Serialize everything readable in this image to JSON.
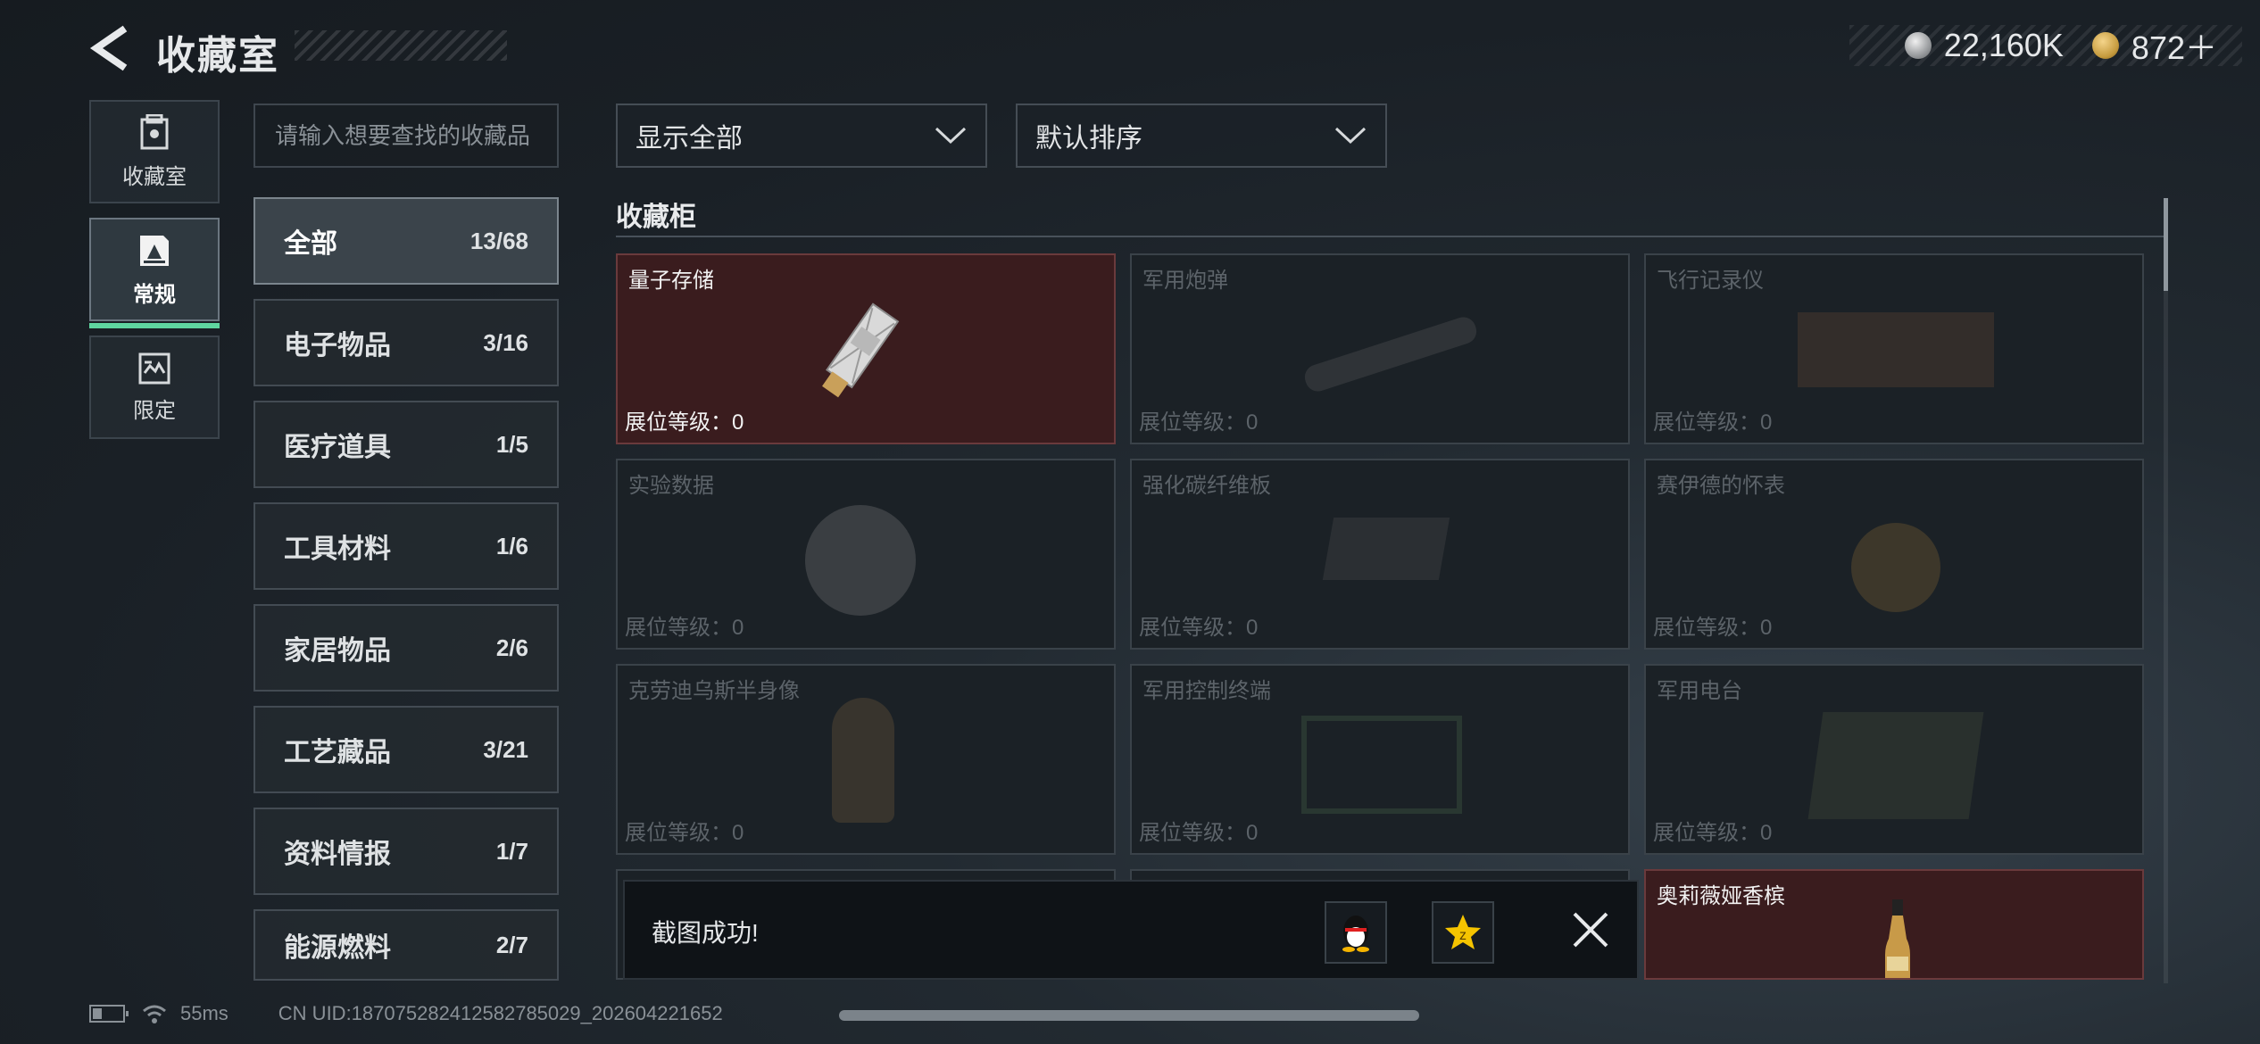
{
  "header": {
    "title": "收藏室"
  },
  "currency": [
    {
      "icon": "silver-coin-icon",
      "value": "22,160K"
    },
    {
      "icon": "gold-coin-icon",
      "value": "872＋"
    }
  ],
  "left_tabs": [
    {
      "label": "收藏室",
      "icon": "collection-room-icon",
      "active": false
    },
    {
      "label": "常规",
      "icon": "regular-icon",
      "active": true
    },
    {
      "label": "限定",
      "icon": "limited-icon",
      "active": false
    }
  ],
  "search": {
    "placeholder": "请输入想要查找的收藏品"
  },
  "categories": [
    {
      "label": "全部",
      "count": "13/68"
    },
    {
      "label": "电子物品",
      "count": "3/16"
    },
    {
      "label": "医疗道具",
      "count": "1/5"
    },
    {
      "label": "工具材料",
      "count": "1/6"
    },
    {
      "label": "家居物品",
      "count": "2/6"
    },
    {
      "label": "工艺藏品",
      "count": "3/21"
    },
    {
      "label": "资料情报",
      "count": "1/7"
    },
    {
      "label": "能源燃料",
      "count": "2/7"
    }
  ],
  "filters": {
    "show": "显示全部",
    "sort": "默认排序"
  },
  "section_title": "收藏柜",
  "items": [
    {
      "name": "量子存储",
      "level": "展位等级：0",
      "owned": true
    },
    {
      "name": "军用炮弹",
      "level": "展位等级：0",
      "owned": false
    },
    {
      "name": "飞行记录仪",
      "level": "展位等级：0",
      "owned": false
    },
    {
      "name": "实验数据",
      "level": "展位等级：0",
      "owned": false
    },
    {
      "name": "强化碳纤维板",
      "level": "展位等级：0",
      "owned": false
    },
    {
      "name": "赛伊德的怀表",
      "level": "展位等级：0",
      "owned": false
    },
    {
      "name": "克劳迪乌斯半身像",
      "level": "展位等级：0",
      "owned": false
    },
    {
      "name": "军用控制终端",
      "level": "展位等级：0",
      "owned": false
    },
    {
      "name": "军用电台",
      "level": "展位等级：0",
      "owned": false
    },
    {
      "name": "",
      "level": "",
      "owned": false
    },
    {
      "name": "",
      "level": "",
      "owned": false
    },
    {
      "name": "奥莉薇娅香槟",
      "level": "",
      "owned": true
    }
  ],
  "toast": {
    "message": "截图成功!",
    "share_qq_icon": "qq-penguin-icon",
    "share_qzone_icon": "qzone-star-icon"
  },
  "footer": {
    "ping": "55ms",
    "uid": "CN UID:18707528241258278502​9_202604221652"
  },
  "colors": {
    "accent": "#5fd6a0",
    "owned_bg": "#3a1c1e"
  }
}
